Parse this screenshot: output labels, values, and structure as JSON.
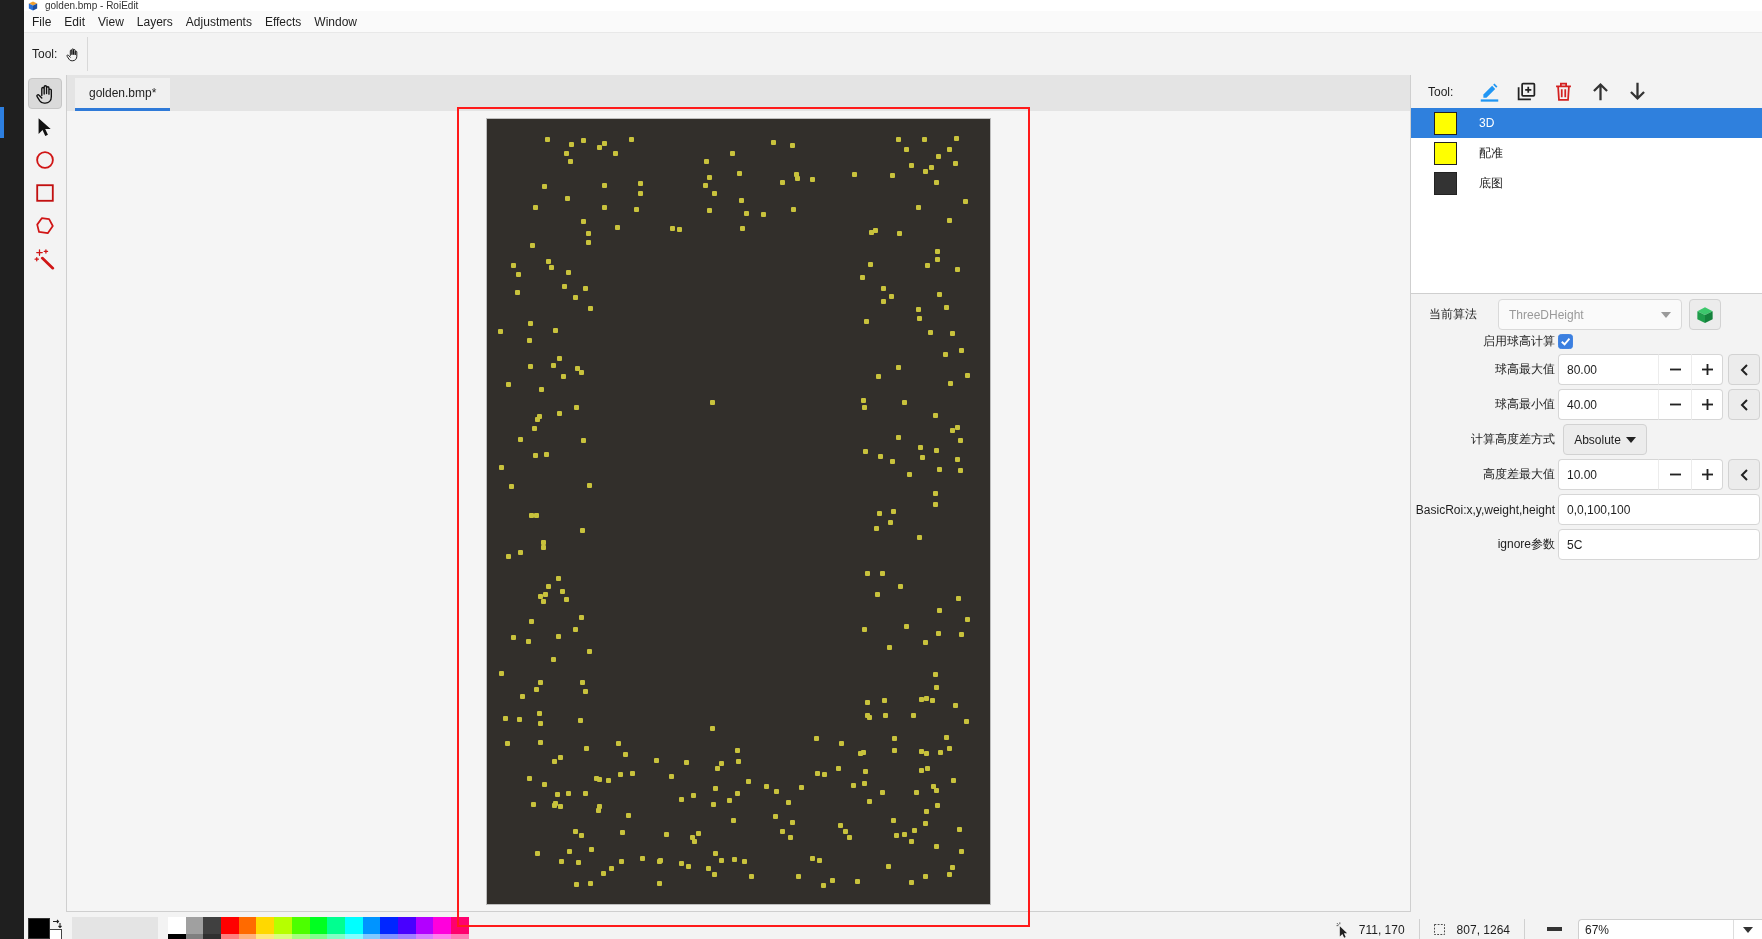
{
  "window": {
    "title": "golden.bmp - RoiEdit"
  },
  "menu": [
    "File",
    "Edit",
    "View",
    "Layers",
    "Adjustments",
    "Effects",
    "Window"
  ],
  "toolbar": {
    "label": "Tool:"
  },
  "tools": [
    {
      "kind": "pan",
      "selected": true
    },
    {
      "kind": "pointer",
      "selected": false
    },
    {
      "kind": "ellipse",
      "selected": false
    },
    {
      "kind": "rectangle",
      "selected": false
    },
    {
      "kind": "polygon",
      "selected": false
    },
    {
      "kind": "magic_wand",
      "selected": false
    }
  ],
  "document_tabs": [
    {
      "label": "golden.bmp*",
      "selected": true
    }
  ],
  "layers_panel": {
    "tool_label": "Tool:",
    "layers": [
      {
        "name": "3D",
        "color": "#ffff00",
        "selected": true
      },
      {
        "name": "配准",
        "color": "#ffff00",
        "selected": false
      },
      {
        "name": "底图",
        "color": "#333333",
        "selected": false
      }
    ]
  },
  "properties": [
    {
      "kind": "combo",
      "label": "当前算法",
      "value": "ThreeDHeight",
      "disabled": true
    },
    {
      "kind": "checkbox",
      "label": "启用球高计算",
      "checked": true
    },
    {
      "kind": "spinner",
      "label": "球高最大值",
      "value": "80.00"
    },
    {
      "kind": "spinner",
      "label": "球高最小值",
      "value": "40.00"
    },
    {
      "kind": "dropdown",
      "label": "计算高度差方式",
      "value": "Absolute"
    },
    {
      "kind": "spinner",
      "label": "高度差最大值",
      "value": "10.00"
    },
    {
      "kind": "text",
      "label": "BasicRoi:x,y,weight,height",
      "value": "0,0,100,100"
    },
    {
      "kind": "text",
      "label": "ignore参数",
      "value": "5C"
    }
  ],
  "palette": {
    "primary": {
      "color": "#000000"
    },
    "secondary": {
      "color": "#ffffff"
    },
    "rows": [
      {
        "swatches": [
          {
            "color": "#ffffff"
          },
          {
            "color": "#a0a0a0"
          },
          {
            "color": "#404040"
          },
          {
            "color": "#ff0000"
          },
          {
            "color": "#ff6a00"
          },
          {
            "color": "#ffd800"
          },
          {
            "color": "#b6ff00"
          },
          {
            "color": "#4cff00"
          },
          {
            "color": "#00ff21"
          },
          {
            "color": "#00ff90"
          },
          {
            "color": "#00ffff"
          },
          {
            "color": "#0094ff"
          },
          {
            "color": "#0026ff"
          },
          {
            "color": "#4800ff"
          },
          {
            "color": "#b200ff"
          },
          {
            "color": "#ff00dc"
          },
          {
            "color": "#ff006e"
          }
        ]
      },
      {
        "swatches": [
          {
            "color": "#000000"
          },
          {
            "color": "#808080"
          },
          {
            "color": "#303030"
          },
          {
            "color": "#ff7f7f"
          },
          {
            "color": "#ffb27f"
          },
          {
            "color": "#ffe97f"
          },
          {
            "color": "#daff7f"
          },
          {
            "color": "#a5ff7f"
          },
          {
            "color": "#7fff8e"
          },
          {
            "color": "#7fffc5"
          },
          {
            "color": "#7fffff"
          },
          {
            "color": "#7fc9ff"
          },
          {
            "color": "#7f92ff"
          },
          {
            "color": "#a17fff"
          },
          {
            "color": "#d67fff"
          },
          {
            "color": "#ff7fed"
          },
          {
            "color": "#ff7fb6"
          }
        ]
      }
    ]
  },
  "status_bar": {
    "cursor_position": "711, 170",
    "selection_size": "807, 1264",
    "zoom": "67%"
  }
}
